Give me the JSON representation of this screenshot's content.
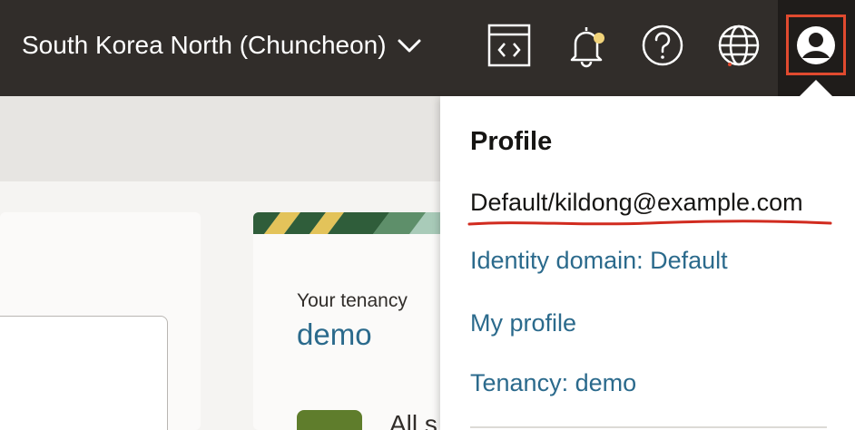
{
  "topbar": {
    "region_label": "South Korea North (Chuncheon)",
    "icons": [
      "code-editor-icon",
      "bell-icon",
      "help-icon",
      "globe-icon",
      "user-avatar-icon"
    ],
    "notification_dot_color": "#f1d37a"
  },
  "tenancy_card": {
    "label": "Your tenancy",
    "value": "demo",
    "partial_text": "All s"
  },
  "profile_menu": {
    "title": "Profile",
    "user_email": "Default/kildong@example.com",
    "items": [
      {
        "label": "Identity domain: Default"
      },
      {
        "label": "My profile"
      },
      {
        "label": "Tenancy: demo"
      }
    ]
  },
  "colors": {
    "topbar_bg": "#312d2a",
    "link": "#2b6a8c",
    "highlight_border": "#e04a2f",
    "annotation_underline": "#d12b1f"
  }
}
